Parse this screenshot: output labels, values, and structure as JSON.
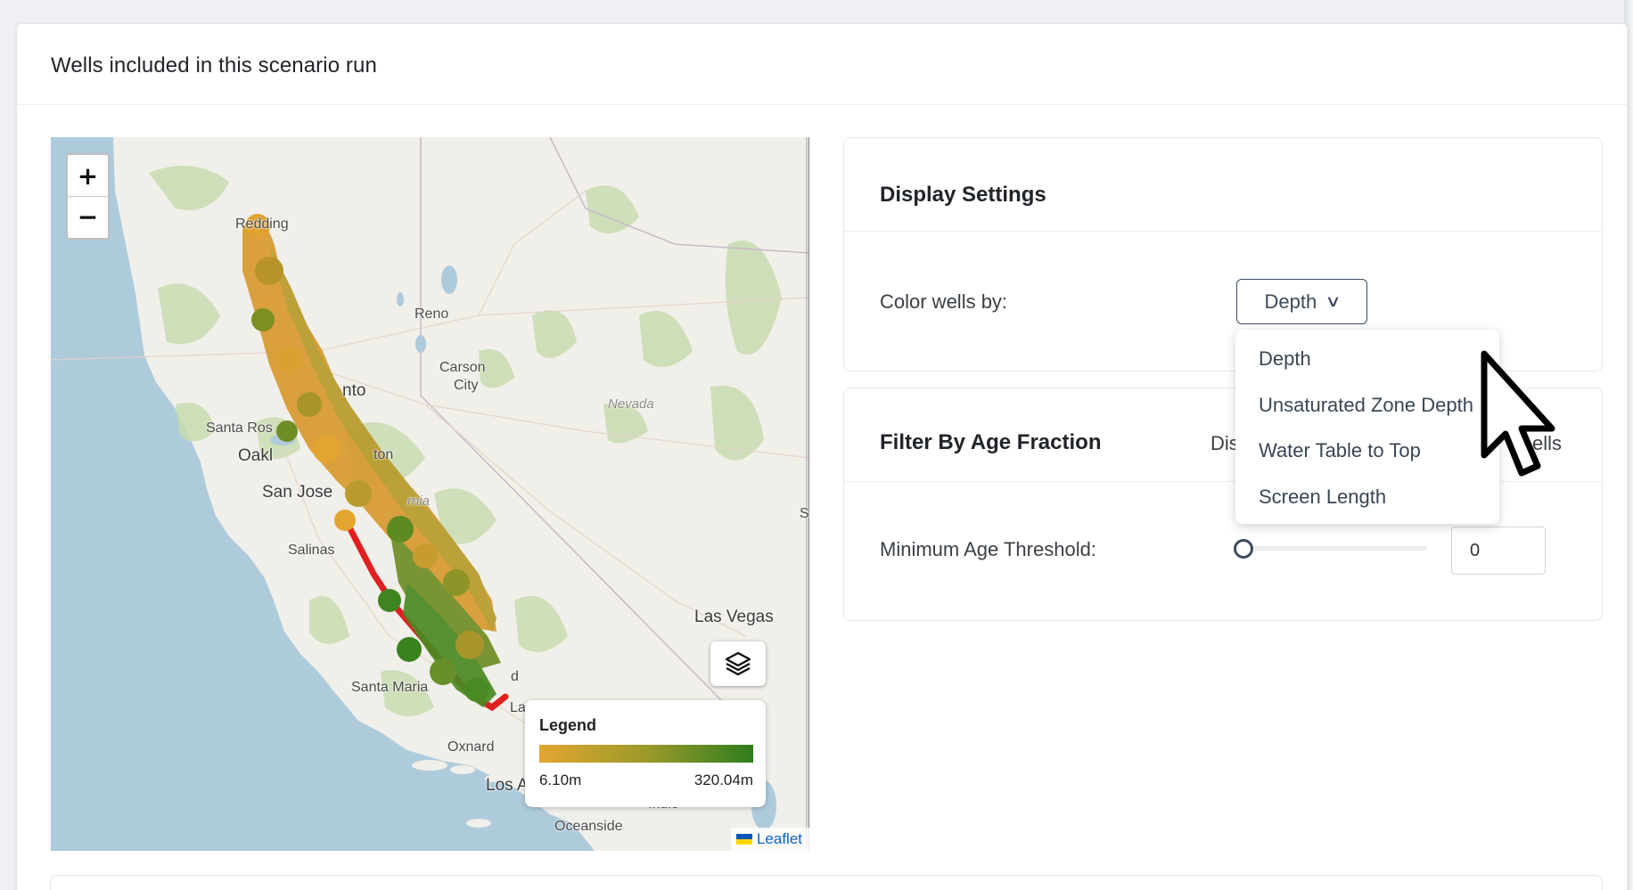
{
  "card": {
    "title": "Wells included in this scenario run"
  },
  "map": {
    "zoom_in": "+",
    "zoom_out": "−",
    "labels": {
      "redding": "Redding",
      "reno": "Reno",
      "carson": "Carson",
      "city": "City",
      "nevada": "Nevada",
      "sacramento": "nto",
      "santa_rosa": "Santa Ros",
      "oakland": "Oakl",
      "stockton": "ton",
      "san_jose": "San Jose",
      "california": "rnia",
      "salinas": "Salinas",
      "las_vegas": "Las Vegas",
      "santa_maria": "Santa Maria",
      "bakersfield": "d",
      "lancaster": "La",
      "oxnard": "Oxnard",
      "los_angeles": "Los A",
      "indio": "Indio",
      "oceanside": "Oceanside",
      "edge_s": "S"
    },
    "layers_icon": "layers-icon",
    "legend": {
      "title": "Legend",
      "min": "6.10m",
      "max": "320.04m",
      "color_low": "#e3a531",
      "color_high": "#2f7d1e"
    },
    "attribution": "Leaflet"
  },
  "display_settings": {
    "title": "Display Settings",
    "color_label": "Color wells by:",
    "selected": "Depth",
    "options": [
      "Depth",
      "Unsaturated Zone Depth",
      "Water Table to Top",
      "Screen Length"
    ]
  },
  "age_filter": {
    "title": "Filter By Age Fraction",
    "peek_left": "Dis",
    "peek_right": "ells",
    "threshold_label": "Minimum Age Threshold:",
    "threshold_value": "0",
    "slider_fraction": 0
  }
}
